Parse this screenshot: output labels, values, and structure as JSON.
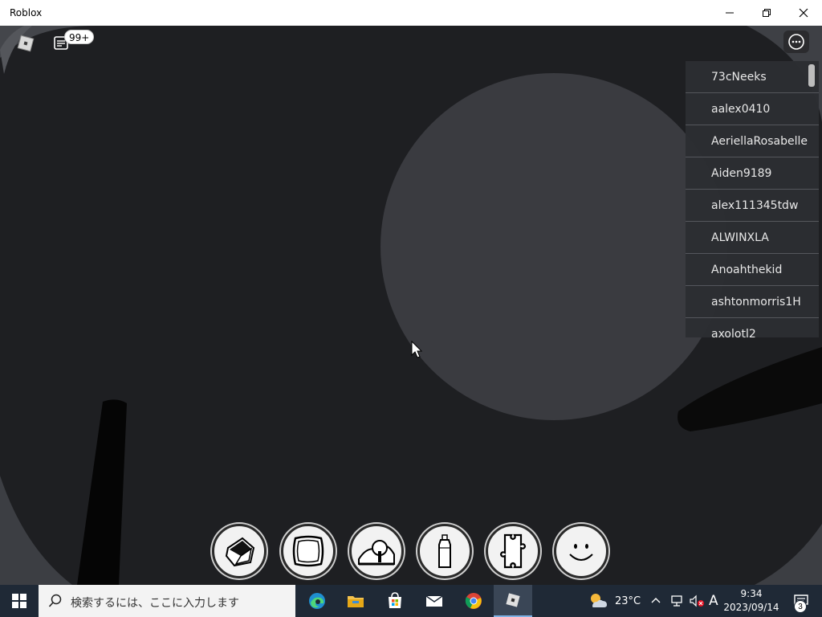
{
  "window": {
    "title": "Roblox"
  },
  "hud": {
    "chat_badge": "99+"
  },
  "playerlist": {
    "players": [
      "73cNeeks",
      "aalex0410",
      "AeriellaRosabelle",
      "Aiden9189",
      "alex111345tdw",
      "ALWINXLA",
      "Anoahthekid",
      "ashtonmorris1H",
      "axolotl2"
    ]
  },
  "hotbar": {
    "items": [
      {
        "icon": "cube-icon"
      },
      {
        "icon": "slab-icon"
      },
      {
        "icon": "landscape-tree-icon"
      },
      {
        "icon": "spray-bottle-icon"
      },
      {
        "icon": "puzzle-piece-icon"
      },
      {
        "icon": "smiley-face-icon"
      }
    ]
  },
  "taskbar": {
    "search_placeholder": "検索するには、ここに入力します",
    "apps": [
      "edge-icon",
      "file-explorer-icon",
      "store-icon",
      "mail-icon",
      "chrome-icon",
      "roblox-icon"
    ],
    "weather_temp": "23°C",
    "ime_indicator": "A",
    "time": "9:34",
    "date": "2023/09/14",
    "notification_count": "3"
  },
  "colors": {
    "scene_bg": "#1e1f22",
    "sphere": "#3a3b40",
    "taskbar": "#1f2936",
    "playerlist_row": "#2c2e32"
  }
}
